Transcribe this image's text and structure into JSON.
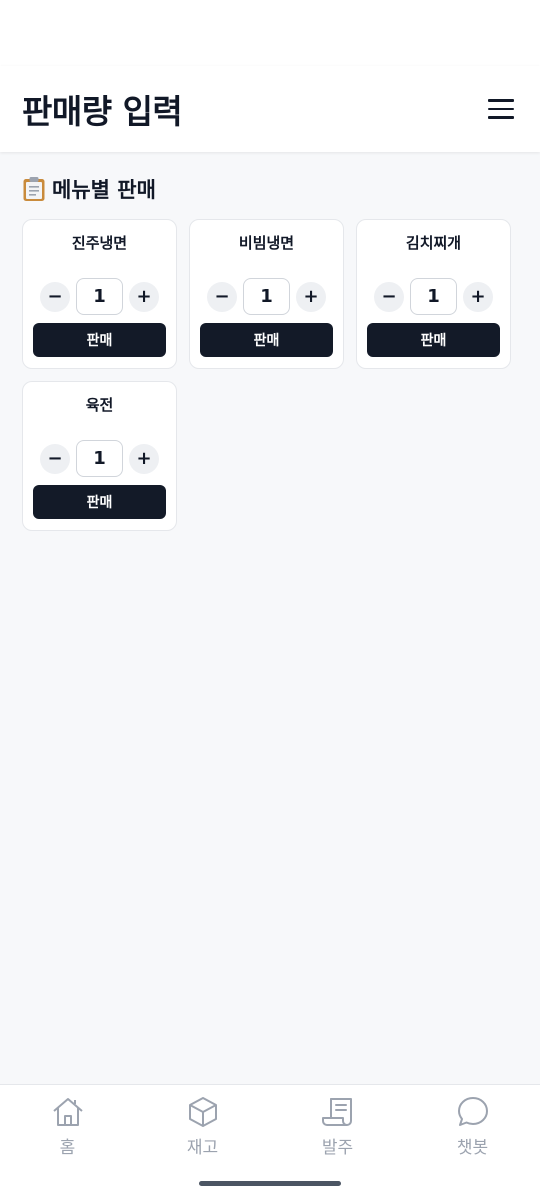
{
  "header": {
    "title": "판매량 입력",
    "menu_icon": "hamburger-icon"
  },
  "section": {
    "icon": "clipboard-icon",
    "title": "메뉴별 판매"
  },
  "menus": [
    {
      "name": "진주냉면",
      "qty": "1",
      "minus": "−",
      "plus": "+",
      "sell_label": "판매"
    },
    {
      "name": "비빔냉면",
      "qty": "1",
      "minus": "−",
      "plus": "+",
      "sell_label": "판매"
    },
    {
      "name": "김치찌개",
      "qty": "1",
      "minus": "−",
      "plus": "+",
      "sell_label": "판매"
    },
    {
      "name": "육전",
      "qty": "1",
      "minus": "−",
      "plus": "+",
      "sell_label": "판매"
    }
  ],
  "nav": [
    {
      "label": "홈",
      "icon": "home-icon"
    },
    {
      "label": "재고",
      "icon": "box-icon"
    },
    {
      "label": "발주",
      "icon": "receipt-icon"
    },
    {
      "label": "챗봇",
      "icon": "chat-bubble-icon"
    }
  ],
  "colors": {
    "primary_button": "#131a28",
    "nav_inactive": "#9ca3af",
    "background": "#f7f8fa"
  }
}
